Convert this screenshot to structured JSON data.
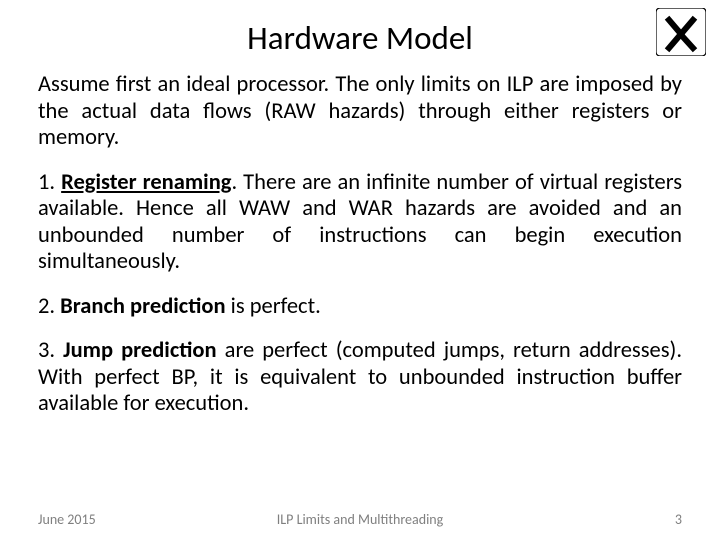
{
  "title": "Hardware Model",
  "intro": "Assume first an ideal processor. The only limits on ILP are imposed by the actual data flows (RAW hazards) through either registers or memory.",
  "p1_num": "1. ",
  "p1_term": "Register renaming",
  "p1_rest": ". There are an infinite number of virtual registers available. Hence all WAW and WAR hazards are avoided and an unbounded number of instructions can begin execution simultaneously.",
  "p2_num": "2. ",
  "p2_term": "Branch prediction",
  "p2_rest": " is perfect.",
  "p3_num": "3. ",
  "p3_term": "Jump prediction",
  "p3_rest": " are perfect (computed jumps, return addresses). With perfect BP, it is equivalent to unbounded instruction buffer available for execution.",
  "footer": {
    "date": "June 2015",
    "center": "ILP Limits and Multithreading",
    "page": "3"
  }
}
